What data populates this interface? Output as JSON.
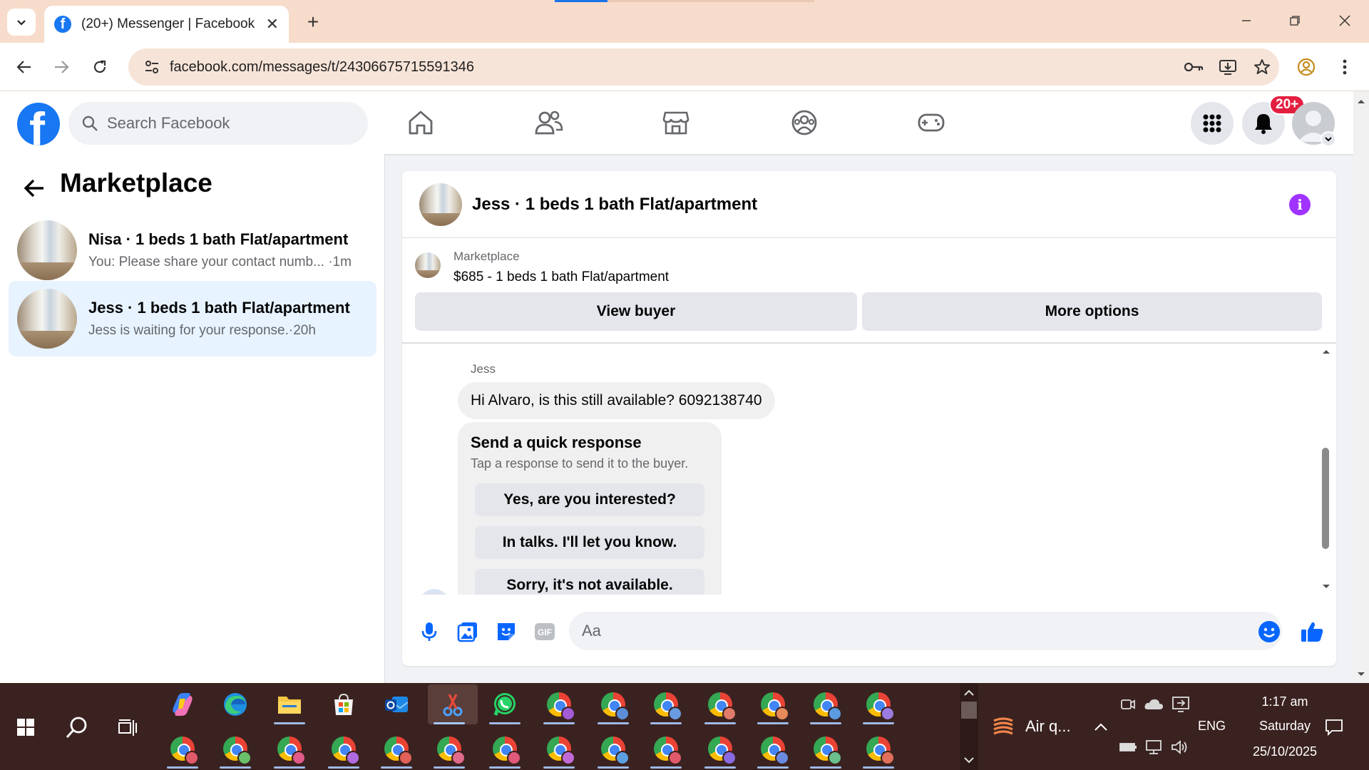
{
  "browser": {
    "tab_title": "(20+) Messenger | Facebook",
    "url": "facebook.com/messages/t/24306675715591346"
  },
  "fb_header": {
    "search_placeholder": "Search Facebook",
    "notification_badge": "20+"
  },
  "left_panel": {
    "title": "Marketplace",
    "conversations": [
      {
        "name": "Nisa · 1 beds 1 bath Flat/apartment",
        "preview": "You: Please share your contact numb... ·1m",
        "active": false
      },
      {
        "name": "Jess · 1 beds 1 bath Flat/apartment",
        "preview": "Jess is waiting for your response.·20h",
        "active": true
      }
    ]
  },
  "chat": {
    "title": "Jess · 1 beds 1 bath Flat/apartment",
    "marketplace_label": "Marketplace",
    "listing": "$685 - 1 beds 1 bath Flat/apartment",
    "view_buyer_label": "View buyer",
    "more_options_label": "More options",
    "sender_name": "Jess",
    "message": "Hi Alvaro, is this still available? 6092138740",
    "quick_response": {
      "title": "Send a quick response",
      "subtitle": "Tap a response to send it to the buyer.",
      "options": [
        "Yes, are you interested?",
        "In talks. I'll let you know.",
        "Sorry, it's not available."
      ]
    },
    "composer_placeholder": "Aa"
  },
  "taskbar": {
    "weather_text": "Air q...",
    "language": "ENG",
    "time": "1:17 am",
    "day": "Saturday",
    "date": "25/10/2025"
  },
  "colors": {
    "fb_blue": "#1877f2",
    "active_conv_bg": "#e7f3ff",
    "badge_red": "#e41e3f",
    "info_purple": "#a033ff",
    "tabbar_bg": "#f7dccb",
    "taskbar_bg": "#3a2220"
  }
}
